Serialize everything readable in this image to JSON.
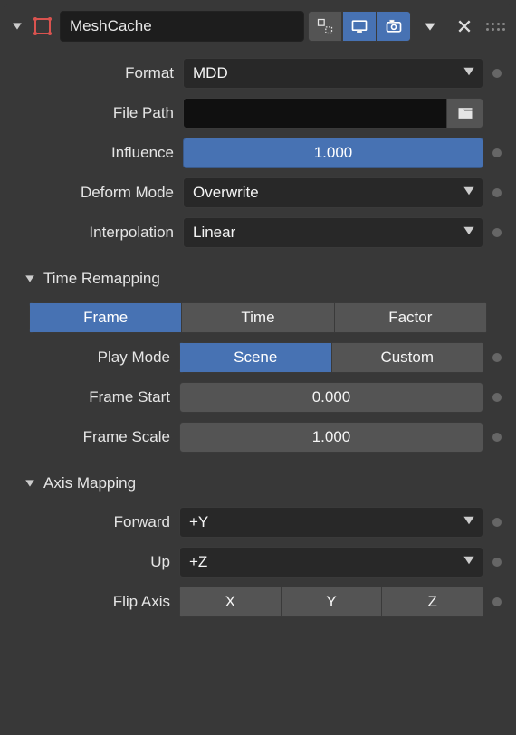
{
  "header": {
    "name": "MeshCache"
  },
  "main": {
    "format": {
      "label": "Format",
      "value": "MDD"
    },
    "file_path": {
      "label": "File Path",
      "value": ""
    },
    "influence": {
      "label": "Influence",
      "value": "1.000"
    },
    "deform_mode": {
      "label": "Deform Mode",
      "value": "Overwrite"
    },
    "interpolation": {
      "label": "Interpolation",
      "value": "Linear"
    }
  },
  "time_remapping": {
    "title": "Time Remapping",
    "tabs": {
      "frame": "Frame",
      "time": "Time",
      "factor": "Factor",
      "active": "frame"
    },
    "play_mode": {
      "label": "Play Mode",
      "scene": "Scene",
      "custom": "Custom",
      "active": "scene"
    },
    "frame_start": {
      "label": "Frame Start",
      "value": "0.000"
    },
    "frame_scale": {
      "label": "Frame Scale",
      "value": "1.000"
    }
  },
  "axis_mapping": {
    "title": "Axis Mapping",
    "forward": {
      "label": "Forward",
      "value": "+Y"
    },
    "up": {
      "label": "Up",
      "value": "+Z"
    },
    "flip_axis": {
      "label": "Flip Axis",
      "x": "X",
      "y": "Y",
      "z": "Z"
    }
  }
}
